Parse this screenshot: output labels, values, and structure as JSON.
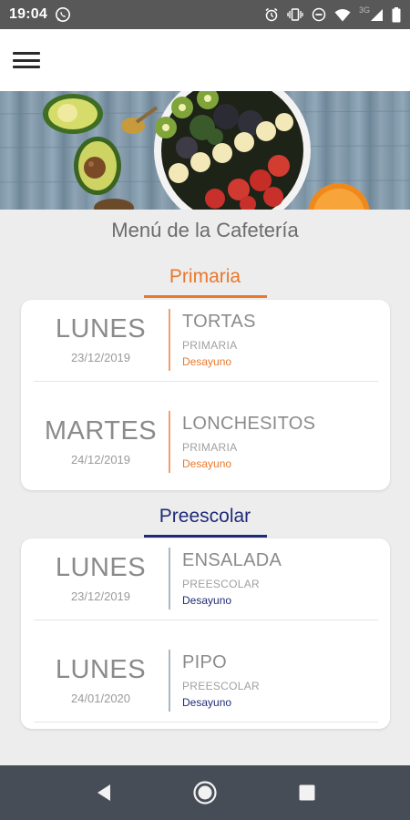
{
  "status_bar": {
    "time": "19:04",
    "network_label": "3G",
    "icons": [
      "whatsapp-icon",
      "alarm-icon",
      "vibrate-icon",
      "do-not-disturb-icon",
      "wifi-icon",
      "signal-icon",
      "battery-icon"
    ]
  },
  "app_bar": {
    "menu_icon": "hamburger-menu-icon"
  },
  "hero": {
    "image": "food-bowl-avocado-photo"
  },
  "page_title": "Menú de la Cafetería",
  "colors": {
    "primaria": "#e8782e",
    "preescolar": "#1f2b78",
    "text_gray": "#8b8b8b"
  },
  "sections": [
    {
      "title": "Primaria",
      "entries": [
        {
          "day": "LUNES",
          "date": "23/12/2019",
          "dish": "TORTAS",
          "level": "PRIMARIA",
          "meal": "Desayuno"
        },
        {
          "day": "MARTES",
          "date": "24/12/2019",
          "dish": "LONCHESITOS",
          "level": "PRIMARIA",
          "meal": "Desayuno"
        }
      ]
    },
    {
      "title": "Preescolar",
      "entries": [
        {
          "day": "LUNES",
          "date": "23/12/2019",
          "dish": "ENSALADA",
          "level": "PREESCOLAR",
          "meal": "Desayuno"
        },
        {
          "day": "LUNES",
          "date": "24/01/2020",
          "dish": "PIPO",
          "level": "PREESCOLAR",
          "meal": "Desayuno"
        }
      ]
    }
  ],
  "nav_bar": {
    "buttons": [
      "back-icon",
      "home-icon",
      "recents-icon"
    ]
  }
}
